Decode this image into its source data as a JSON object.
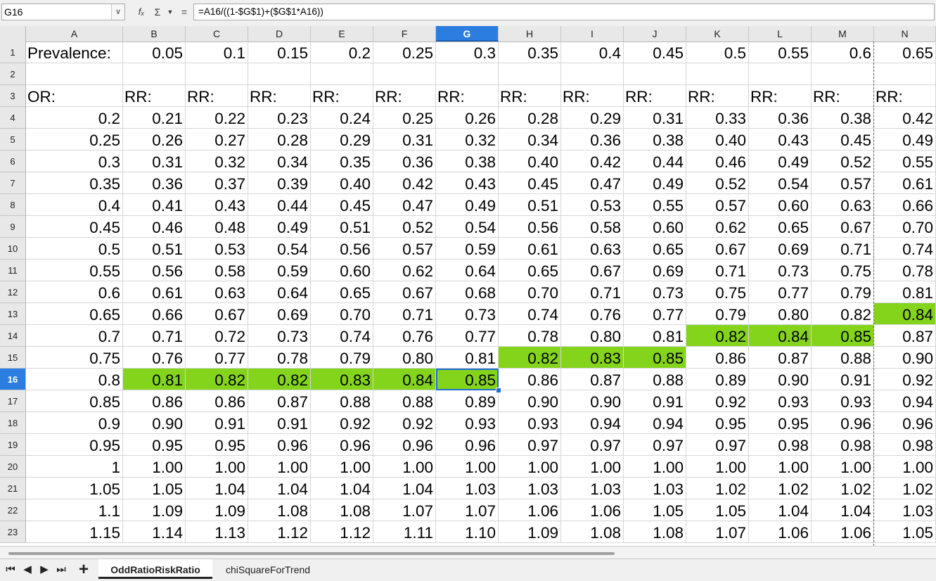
{
  "formula_bar": {
    "name_box": "G16",
    "formula": "=A16/((1-$G$1)+($G$1*A16))"
  },
  "columns": [
    "A",
    "B",
    "C",
    "D",
    "E",
    "F",
    "G",
    "H",
    "I",
    "J",
    "K",
    "L",
    "M",
    "N"
  ],
  "selected_column": "G",
  "selected_row": "16",
  "active_cell": "G16",
  "highlight_color": "#84d41c",
  "rows": [
    {
      "n": "1",
      "cells": [
        "Prevalence:",
        "0.05",
        "0.1",
        "0.15",
        "0.2",
        "0.25",
        "0.3",
        "0.35",
        "0.4",
        "0.45",
        "0.5",
        "0.55",
        "0.6",
        "0.65"
      ]
    },
    {
      "n": "2",
      "cells": [
        "",
        "",
        "",
        "",
        "",
        "",
        "",
        "",
        "",
        "",
        "",
        "",
        "",
        ""
      ]
    },
    {
      "n": "3",
      "cells": [
        "OR:",
        "RR:",
        "RR:",
        "RR:",
        "RR:",
        "RR:",
        "RR:",
        "RR:",
        "RR:",
        "RR:",
        "RR:",
        "RR:",
        "RR:",
        "RR:"
      ]
    },
    {
      "n": "4",
      "cells": [
        "0.2",
        "0.21",
        "0.22",
        "0.23",
        "0.24",
        "0.25",
        "0.26",
        "0.28",
        "0.29",
        "0.31",
        "0.33",
        "0.36",
        "0.38",
        "0.42"
      ]
    },
    {
      "n": "5",
      "cells": [
        "0.25",
        "0.26",
        "0.27",
        "0.28",
        "0.29",
        "0.31",
        "0.32",
        "0.34",
        "0.36",
        "0.38",
        "0.40",
        "0.43",
        "0.45",
        "0.49"
      ]
    },
    {
      "n": "6",
      "cells": [
        "0.3",
        "0.31",
        "0.32",
        "0.34",
        "0.35",
        "0.36",
        "0.38",
        "0.40",
        "0.42",
        "0.44",
        "0.46",
        "0.49",
        "0.52",
        "0.55"
      ]
    },
    {
      "n": "7",
      "cells": [
        "0.35",
        "0.36",
        "0.37",
        "0.39",
        "0.40",
        "0.42",
        "0.43",
        "0.45",
        "0.47",
        "0.49",
        "0.52",
        "0.54",
        "0.57",
        "0.61"
      ]
    },
    {
      "n": "8",
      "cells": [
        "0.4",
        "0.41",
        "0.43",
        "0.44",
        "0.45",
        "0.47",
        "0.49",
        "0.51",
        "0.53",
        "0.55",
        "0.57",
        "0.60",
        "0.63",
        "0.66"
      ]
    },
    {
      "n": "9",
      "cells": [
        "0.45",
        "0.46",
        "0.48",
        "0.49",
        "0.51",
        "0.52",
        "0.54",
        "0.56",
        "0.58",
        "0.60",
        "0.62",
        "0.65",
        "0.67",
        "0.70"
      ]
    },
    {
      "n": "10",
      "cells": [
        "0.5",
        "0.51",
        "0.53",
        "0.54",
        "0.56",
        "0.57",
        "0.59",
        "0.61",
        "0.63",
        "0.65",
        "0.67",
        "0.69",
        "0.71",
        "0.74"
      ]
    },
    {
      "n": "11",
      "cells": [
        "0.55",
        "0.56",
        "0.58",
        "0.59",
        "0.60",
        "0.62",
        "0.64",
        "0.65",
        "0.67",
        "0.69",
        "0.71",
        "0.73",
        "0.75",
        "0.78"
      ]
    },
    {
      "n": "12",
      "cells": [
        "0.6",
        "0.61",
        "0.63",
        "0.64",
        "0.65",
        "0.67",
        "0.68",
        "0.70",
        "0.71",
        "0.73",
        "0.75",
        "0.77",
        "0.79",
        "0.81"
      ]
    },
    {
      "n": "13",
      "cells": [
        "0.65",
        "0.66",
        "0.67",
        "0.69",
        "0.70",
        "0.71",
        "0.73",
        "0.74",
        "0.76",
        "0.77",
        "0.79",
        "0.80",
        "0.82",
        "0.84"
      ],
      "green": [
        "N"
      ]
    },
    {
      "n": "14",
      "cells": [
        "0.7",
        "0.71",
        "0.72",
        "0.73",
        "0.74",
        "0.76",
        "0.77",
        "0.78",
        "0.80",
        "0.81",
        "0.82",
        "0.84",
        "0.85",
        "0.87"
      ],
      "green": [
        "K",
        "L",
        "M"
      ]
    },
    {
      "n": "15",
      "cells": [
        "0.75",
        "0.76",
        "0.77",
        "0.78",
        "0.79",
        "0.80",
        "0.81",
        "0.82",
        "0.83",
        "0.85",
        "0.86",
        "0.87",
        "0.88",
        "0.90"
      ],
      "green": [
        "H",
        "I",
        "J"
      ]
    },
    {
      "n": "16",
      "cells": [
        "0.8",
        "0.81",
        "0.82",
        "0.82",
        "0.83",
        "0.84",
        "0.85",
        "0.86",
        "0.87",
        "0.88",
        "0.89",
        "0.90",
        "0.91",
        "0.92"
      ],
      "green": [
        "B",
        "C",
        "D",
        "E",
        "F",
        "G"
      ]
    },
    {
      "n": "17",
      "cells": [
        "0.85",
        "0.86",
        "0.86",
        "0.87",
        "0.88",
        "0.88",
        "0.89",
        "0.90",
        "0.90",
        "0.91",
        "0.92",
        "0.93",
        "0.93",
        "0.94"
      ]
    },
    {
      "n": "18",
      "cells": [
        "0.9",
        "0.90",
        "0.91",
        "0.91",
        "0.92",
        "0.92",
        "0.93",
        "0.93",
        "0.94",
        "0.94",
        "0.95",
        "0.95",
        "0.96",
        "0.96"
      ]
    },
    {
      "n": "19",
      "cells": [
        "0.95",
        "0.95",
        "0.95",
        "0.96",
        "0.96",
        "0.96",
        "0.96",
        "0.97",
        "0.97",
        "0.97",
        "0.97",
        "0.98",
        "0.98",
        "0.98"
      ]
    },
    {
      "n": "20",
      "cells": [
        "1",
        "1.00",
        "1.00",
        "1.00",
        "1.00",
        "1.00",
        "1.00",
        "1.00",
        "1.00",
        "1.00",
        "1.00",
        "1.00",
        "1.00",
        "1.00"
      ]
    },
    {
      "n": "21",
      "cells": [
        "1.05",
        "1.05",
        "1.04",
        "1.04",
        "1.04",
        "1.04",
        "1.03",
        "1.03",
        "1.03",
        "1.03",
        "1.02",
        "1.02",
        "1.02",
        "1.02"
      ]
    },
    {
      "n": "22",
      "cells": [
        "1.1",
        "1.09",
        "1.09",
        "1.08",
        "1.08",
        "1.07",
        "1.07",
        "1.06",
        "1.06",
        "1.05",
        "1.05",
        "1.04",
        "1.04",
        "1.03"
      ]
    },
    {
      "n": "23",
      "cells": [
        "1.15",
        "1.14",
        "1.13",
        "1.12",
        "1.12",
        "1.11",
        "1.10",
        "1.09",
        "1.08",
        "1.08",
        "1.07",
        "1.06",
        "1.06",
        "1.05"
      ]
    }
  ],
  "sheet_tabs": {
    "add_label": "+",
    "tabs": [
      {
        "label": "OddRatioRiskRatio",
        "active": true
      },
      {
        "label": "chiSquareForTrend",
        "active": false
      }
    ]
  },
  "icons": {
    "first_sheet": "first-sheet-icon",
    "prev_sheet": "prev-sheet-icon",
    "next_sheet": "next-sheet-icon",
    "last_sheet": "last-sheet-icon",
    "function_wizard": "function-wizard-icon",
    "sum": "sum-icon",
    "formula": "equals-icon"
  }
}
